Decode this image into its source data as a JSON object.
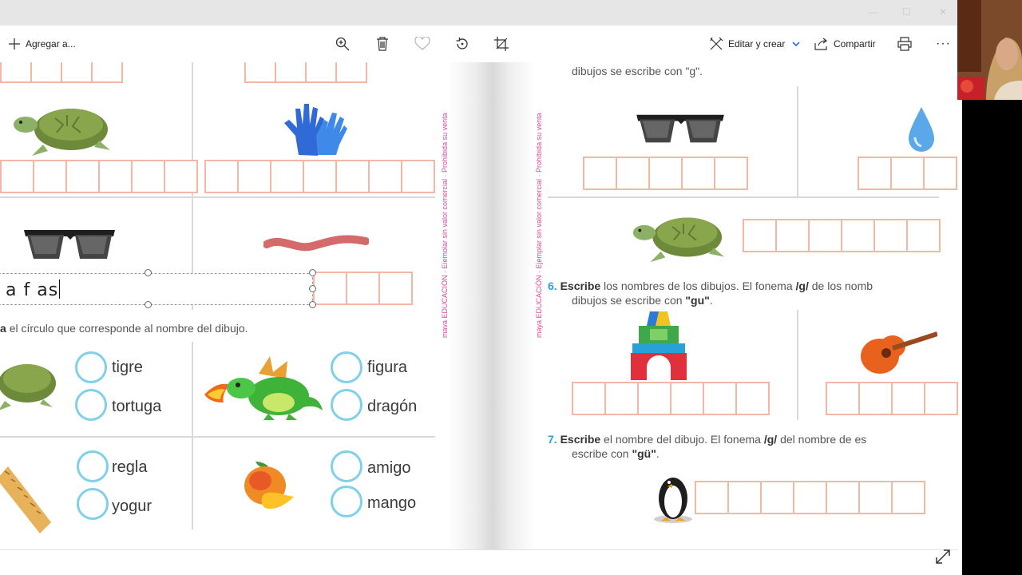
{
  "toolbar": {
    "add_label": "Agregar a...",
    "edit_label": "Editar y crear",
    "share_label": "Compartir"
  },
  "left_page": {
    "instruction": "el círculo que corresponde al nombre del dibujo.",
    "side_brand": "maya EDUCACIÓN · Ejemplar sin valor comercial · Prohibida su venta",
    "options": [
      {
        "a": "tigre",
        "b": "tortuga"
      },
      {
        "a": "figura",
        "b": "dragón"
      },
      {
        "a": "regla",
        "b": "yogur"
      },
      {
        "a": "amigo",
        "b": "mango"
      }
    ]
  },
  "right_page": {
    "top_line": "dibujos se escribe con \"g\".",
    "side_brand": "maya EDUCACIÓN · Ejemplar sin valor comercial · Prohibida su venta",
    "item6": {
      "number": "6.",
      "verb": "Escribe",
      "line1": " los nombres de los dibujos. El fonema ",
      "phoneme": "/g/",
      "line1_end": " de los nomb",
      "line2": "dibujos se escribe con ",
      "line2_bold": "\"gu\"",
      "line2_end": "."
    },
    "item7": {
      "number": "7.",
      "verb": "Escribe",
      "line1": " el nombre del dibujo. El fonema ",
      "phoneme": "/g/",
      "line1_end": " del nombre de es",
      "line2": "escribe con ",
      "line2_bold": "\"gü\"",
      "line2_end": "."
    }
  },
  "text_edit": {
    "value": "a f as"
  }
}
